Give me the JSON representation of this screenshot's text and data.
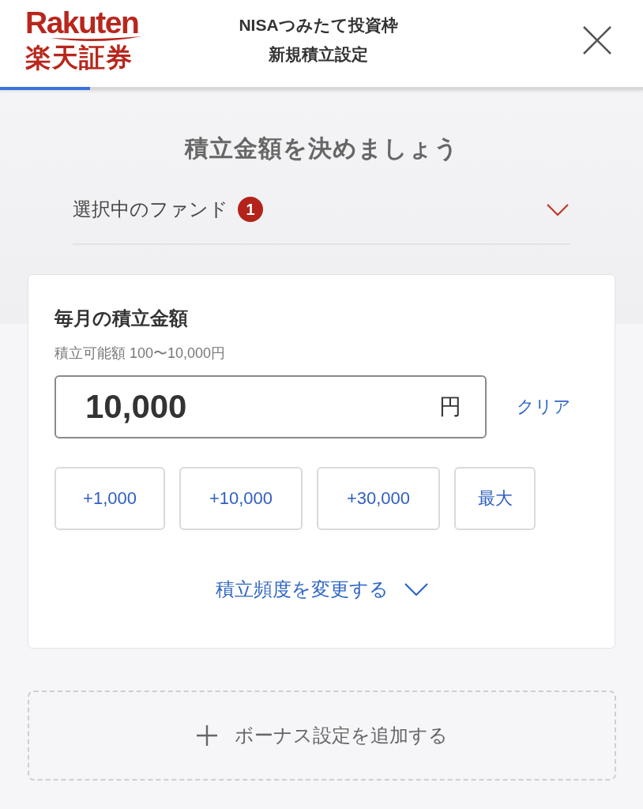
{
  "header": {
    "logo": {
      "wordmark": "Rakuten",
      "name": "楽天証券"
    },
    "title_lines": [
      "NISAつみたて投資枠",
      "新規積立設定"
    ]
  },
  "progress": {
    "level": 0.14
  },
  "heading": "積立金額を決めましょう",
  "selected_funds": {
    "label": "選択中のファンド",
    "count": "1",
    "expanded": false
  },
  "amount_card": {
    "title": "毎月の積立金額",
    "range_hint": "積立可能額 100〜10,000円",
    "amount": {
      "value": "10,000",
      "unit": "円"
    },
    "clear_link": "クリア",
    "quick_add_buttons": [
      "+1,000",
      "+10,000",
      "+30,000",
      "最大"
    ],
    "frequency_link": {
      "label": "積立頻度を変更する",
      "expanded": false
    }
  },
  "bonus_button": {
    "label": "ボーナス設定を追加する"
  }
}
